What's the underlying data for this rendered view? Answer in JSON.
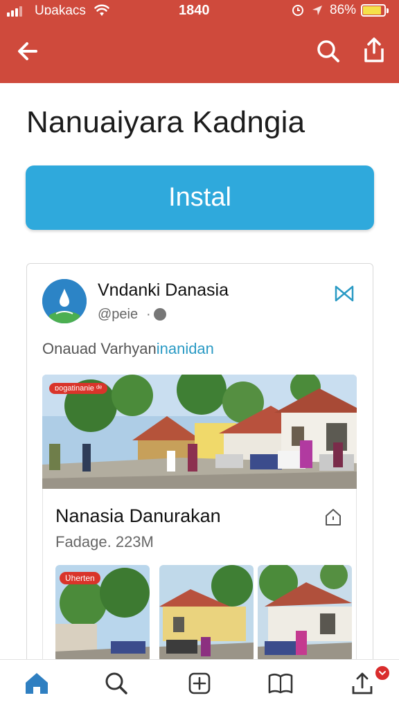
{
  "status_bar": {
    "carrier": "Uɒakacs",
    "time": "1840",
    "battery_percent": "86%",
    "battery_level": 0.86
  },
  "app_bar": {
    "back_icon": "arrow-left-icon",
    "search_icon": "search-icon",
    "share_icon": "share-icon"
  },
  "app": {
    "title": "Nanuaiyara Kadngia",
    "install_label": "Instal"
  },
  "post": {
    "author_name": "Vndanki Danasia",
    "handle": "@peie",
    "separator": "·",
    "text_plain": "Onauad Varhyan",
    "text_link": "inanidan",
    "hero_tag": "ɒogatinanie ᵈᵉ",
    "inner_title": "Nanasia Danurakan",
    "inner_subtitle": "Fadage. 223M",
    "thumbnail_tag": "Ʋherten"
  },
  "colors": {
    "header": "#cf4a3c",
    "install": "#2fa9dc",
    "link": "#2a9ac4",
    "nav_active": "#2f7fc1",
    "badge": "#d92c2c"
  },
  "bottom_nav": {
    "items": [
      "home-icon",
      "search-icon",
      "add-icon",
      "library-icon",
      "upload-icon"
    ],
    "active": "home-icon"
  }
}
